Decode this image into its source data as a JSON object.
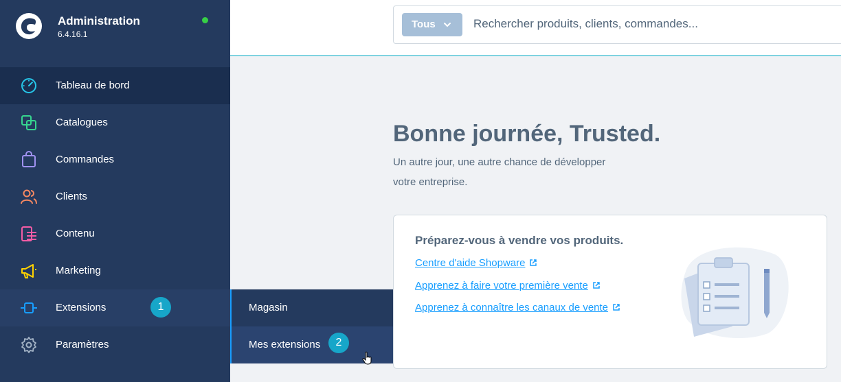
{
  "brand": {
    "title": "Administration",
    "version": "6.4.16.1"
  },
  "nav": [
    {
      "label": "Tableau de bord",
      "icon": "dashboard-icon"
    },
    {
      "label": "Catalogues",
      "icon": "catalog-icon"
    },
    {
      "label": "Commandes",
      "icon": "orders-icon"
    },
    {
      "label": "Clients",
      "icon": "customers-icon"
    },
    {
      "label": "Contenu",
      "icon": "content-icon"
    },
    {
      "label": "Marketing",
      "icon": "marketing-icon"
    },
    {
      "label": "Extensions",
      "icon": "extensions-icon",
      "badge": "1"
    },
    {
      "label": "Paramètres",
      "icon": "settings-icon"
    }
  ],
  "flyout": [
    {
      "label": "Magasin"
    },
    {
      "label": "Mes extensions",
      "badge": "2"
    }
  ],
  "search": {
    "type_label": "Tous",
    "placeholder": "Rechercher produits, clients, commandes..."
  },
  "main": {
    "greeting": "Bonne journée, Trusted.",
    "subtext": "Un autre jour, une autre chance de développer votre entreprise.",
    "card": {
      "title": "Préparez-vous à vendre vos produits.",
      "links": [
        "Centre d'aide Shopware",
        "Apprenez à faire votre première vente",
        "Apprenez à connaître les canaux de vente"
      ]
    }
  },
  "colors": {
    "sidebar": "#243a5e",
    "accent": "#189eff",
    "badge": "#17a6c9",
    "status_online": "#37d046"
  }
}
